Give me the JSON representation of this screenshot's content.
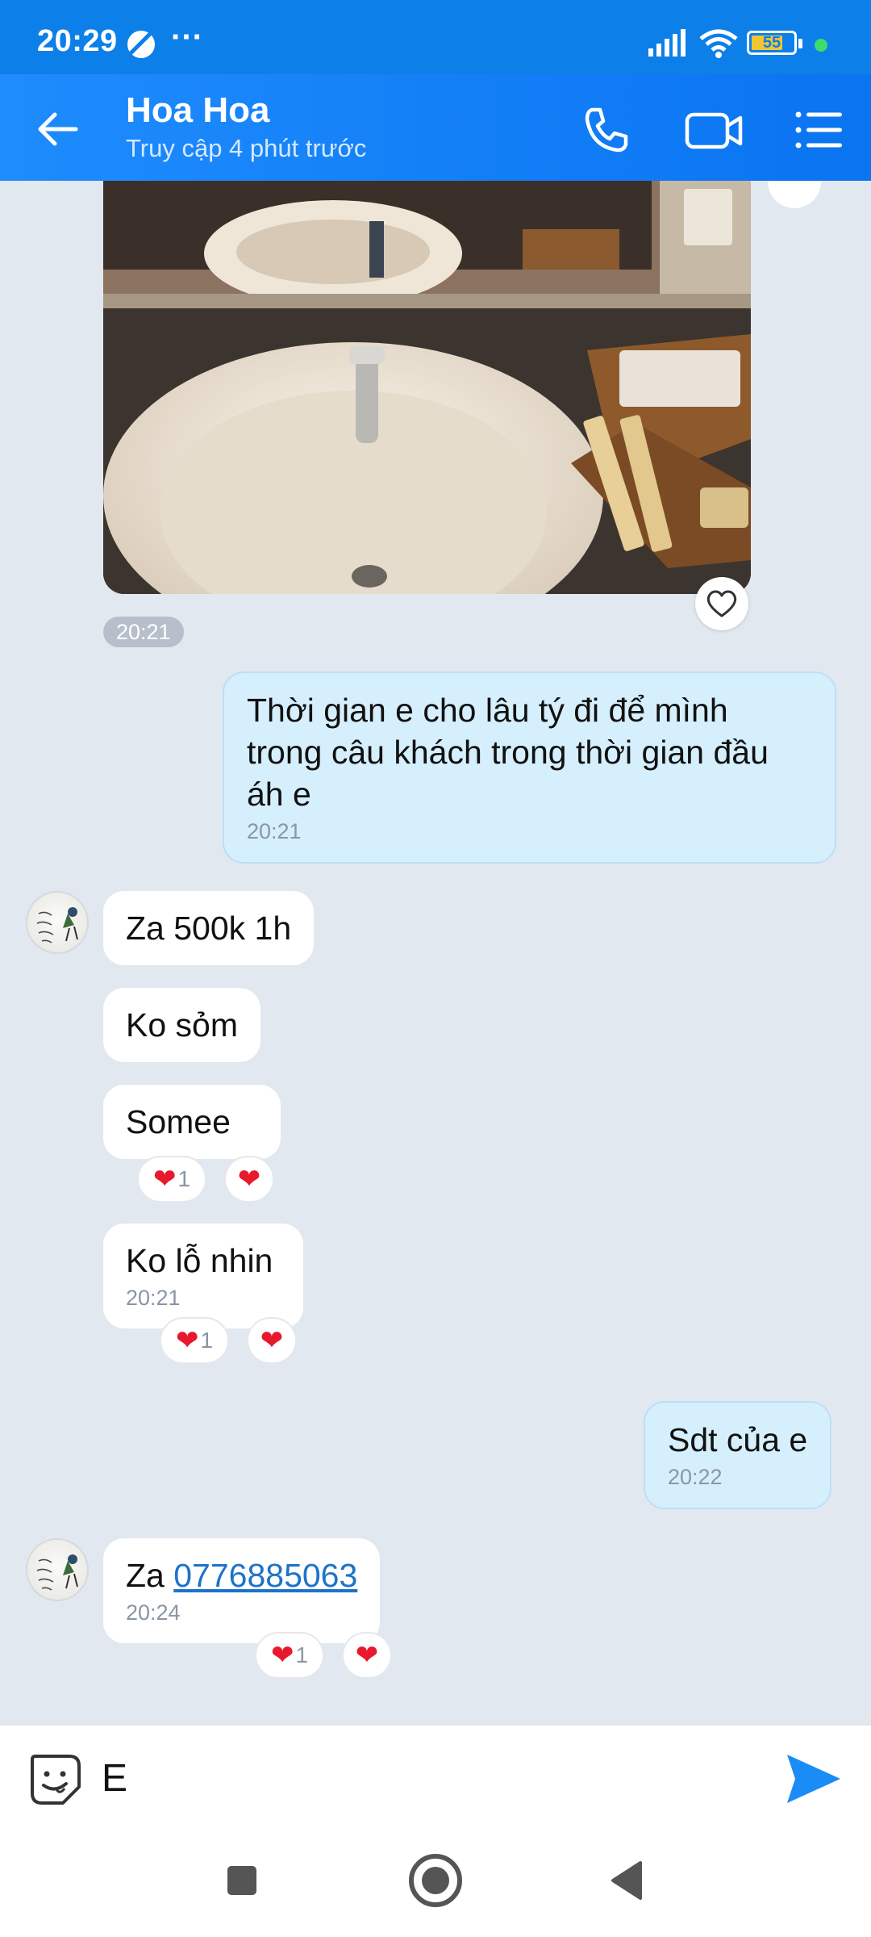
{
  "status_bar": {
    "time": "20:29",
    "more": "···",
    "battery": "55",
    "colors": {
      "bar": "#0d7fe9",
      "battery_fill": "#f2c633",
      "dot": "#3ddc6d"
    }
  },
  "header": {
    "contact_name": "Hoa Hoa",
    "last_seen": "Truy cập 4 phút trước",
    "icons": [
      "back-arrow-icon",
      "phone-icon",
      "video-icon",
      "menu-list-icon"
    ]
  },
  "chat": {
    "photo_time": "20:21",
    "messages": [
      {
        "side": "out",
        "text": "Thời gian e cho lâu tý đi để mình trong câu khách trong thời gian đầu áh e",
        "time": "20:21"
      },
      {
        "side": "in",
        "text": "Za 500k 1h"
      },
      {
        "side": "in",
        "text": "Ko sỏm"
      },
      {
        "side": "in",
        "text": "Somee",
        "reaction_count": "1"
      },
      {
        "side": "in",
        "text": "Ko lỗ nhin",
        "time": "20:21",
        "reaction_count": "1"
      },
      {
        "side": "out",
        "text": "Sdt của e",
        "time": "20:22"
      },
      {
        "side": "in",
        "text_prefix": "Za ",
        "link": "0776885063",
        "time": "20:24",
        "reaction_count": "1"
      }
    ],
    "colors": {
      "background": "#e2e8f0",
      "outgoing": "#d6effd",
      "incoming": "#ffffff",
      "link": "#1d73c9",
      "heart": "#e8192c"
    }
  },
  "composer": {
    "value": "E",
    "icons": [
      "sticker-emoji-icon",
      "send-icon"
    ]
  },
  "nav": {
    "icons": [
      "recents-square-icon",
      "home-circle-icon",
      "back-triangle-icon"
    ]
  }
}
